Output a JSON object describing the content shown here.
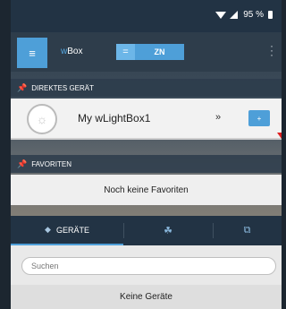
{
  "status": {
    "battery": "95 %"
  },
  "appbar": {
    "brand_prefix": "w",
    "brand_rest": "Box",
    "mode_label": "ZN"
  },
  "direct": {
    "header": "DIREKTES GERÄT",
    "device_name": "My wLightBox1",
    "chevron": "»",
    "add": "+"
  },
  "favorites": {
    "header": "FAVORITEN",
    "empty_text": "Noch keine Favoriten"
  },
  "tabs": [
    {
      "label": "GERÄTE"
    }
  ],
  "search": {
    "placeholder": "Suchen",
    "value": ""
  },
  "devices": {
    "empty_text": "Keine Geräte"
  }
}
